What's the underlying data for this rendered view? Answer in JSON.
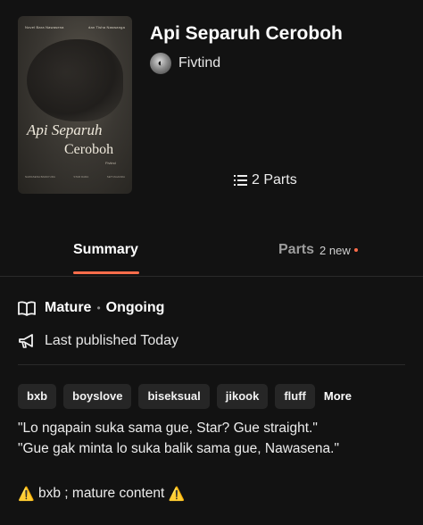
{
  "story": {
    "title": "Api Separuh Ceroboh",
    "author": "Fivtind",
    "parts_label": "2 Parts"
  },
  "cover": {
    "credit_left": "Novel Bara Nawasena",
    "credit_right": "dan Tisha Naswanga",
    "title_line1": "Api Separuh",
    "title_line2": "Ceroboh",
    "signature": "Fivtind",
    "footer_left": "NAWASENA BARAYUDA",
    "footer_mid": "STAR DARA",
    "footer_right": "SETYAGANDA"
  },
  "tabs": {
    "summary": "Summary",
    "parts": "Parts",
    "parts_new": "2 new"
  },
  "meta": {
    "rating": "Mature",
    "separator": "•",
    "status": "Ongoing",
    "published": "Last published Today"
  },
  "tags": [
    "bxb",
    "boyslove",
    "biseksual",
    "jikook",
    "fluff"
  ],
  "tags_more": "More",
  "description": {
    "line1": "\"Lo ngapain suka sama gue, Star? Gue straight.\"",
    "line2": "\"Gue gak minta lo suka balik sama gue, Nawasena.\""
  },
  "warning": {
    "icon": "⚠️",
    "text": " bxb ; mature content "
  },
  "colors": {
    "background": "#121212",
    "accent": "#ff6d4b",
    "tag_bg": "#262626"
  }
}
